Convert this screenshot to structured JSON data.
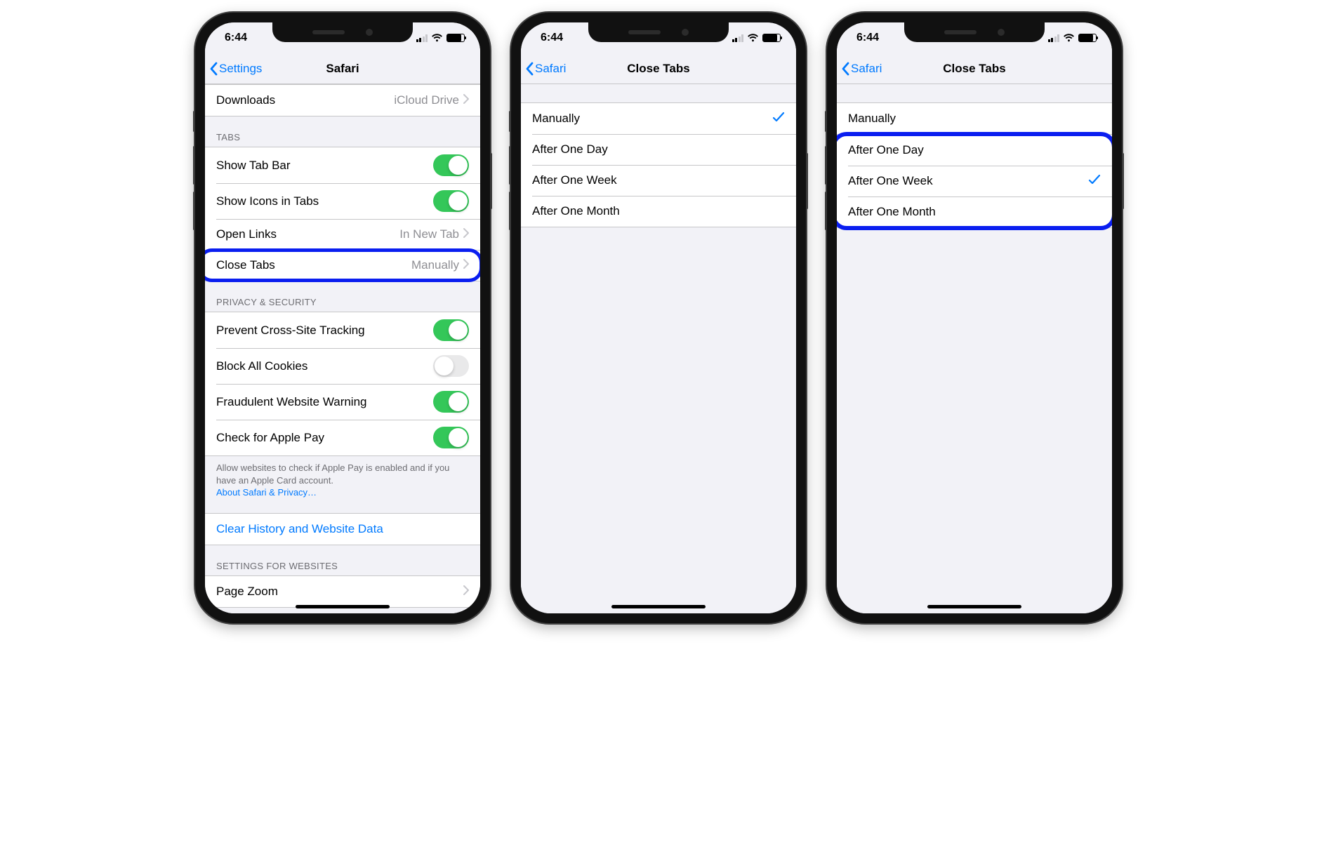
{
  "status": {
    "time": "6:44"
  },
  "colors": {
    "accent": "#007aff",
    "highlight": "#0a1ef0",
    "toggle_on": "#34c759"
  },
  "screen1": {
    "back": "Settings",
    "title": "Safari",
    "rows": {
      "downloads": {
        "label": "Downloads",
        "value": "iCloud Drive"
      }
    },
    "tabs": {
      "header": "Tabs",
      "show_tab_bar": {
        "label": "Show Tab Bar",
        "on": true
      },
      "show_icons": {
        "label": "Show Icons in Tabs",
        "on": true
      },
      "open_links": {
        "label": "Open Links",
        "value": "In New Tab"
      },
      "close_tabs": {
        "label": "Close Tabs",
        "value": "Manually"
      }
    },
    "privacy": {
      "header": "Privacy & Security",
      "cross_site": {
        "label": "Prevent Cross-Site Tracking",
        "on": true
      },
      "block_cookies": {
        "label": "Block All Cookies",
        "on": false
      },
      "fraud": {
        "label": "Fraudulent Website Warning",
        "on": true
      },
      "apple_pay": {
        "label": "Check for Apple Pay",
        "on": true
      },
      "footer": "Allow websites to check if Apple Pay is enabled and if you have an Apple Card account.",
      "footer_link": "About Safari & Privacy…"
    },
    "clear": "Clear History and Website Data",
    "websites": {
      "header": "Settings for Websites",
      "page_zoom": "Page Zoom"
    }
  },
  "screen2": {
    "back": "Safari",
    "title": "Close Tabs",
    "options": [
      "Manually",
      "After One Day",
      "After One Week",
      "After One Month"
    ],
    "selected": 0
  },
  "screen3": {
    "back": "Safari",
    "title": "Close Tabs",
    "options": [
      "Manually",
      "After One Day",
      "After One Week",
      "After One Month"
    ],
    "selected": 2
  }
}
